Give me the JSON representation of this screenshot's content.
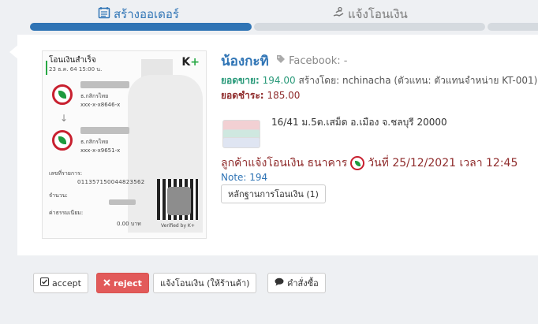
{
  "tabs": [
    {
      "label": "สร้างออเดอร์",
      "icon": "calendar-list-icon",
      "active": true
    },
    {
      "label": "แจ้งโอนเงิน",
      "icon": "hand-money-icon",
      "active": false
    }
  ],
  "order": {
    "customer_name": "น้องกะทิ",
    "facebook": "Facebook: -",
    "sales_label": "ยอดขาย:",
    "sales_value": "194.00",
    "created_by": "สร้างโดย: nchinacha (ตัวแทน: ตัวแทนจำหน่าย KT-001)",
    "paid_label": "ยอดชำระ:",
    "paid_value": "185.00",
    "address": "16/41 ม.5ต.เสม็ด อ.เมือง จ.ชลบุรี 20000",
    "transfer_text_prefix": "ลูกค้าแจ้งโอนเงิน ธนาคาร",
    "transfer_text_suffix": "วันที่ 25/12/2021 เวลา 12:45",
    "note": "Note: 194",
    "proof_button": "หลักฐานการโอนเงิน (1)"
  },
  "slip": {
    "title": "โอนเงินสำเร็จ",
    "date": "23 ธ.ค. 64  15:00 น.",
    "brand": "K",
    "brand_plus": "+",
    "from_bank": "ธ.กสิกรไทย",
    "from_account": "xxx-x-x8646-x",
    "to_bank": "ธ.กสิกรไทย",
    "to_account": "xxx-x-x9651-x",
    "arrow": "↓",
    "ref_label": "เลขที่รายการ:",
    "ref_value": "011357150044823562",
    "amount_label": "จำนวน:",
    "fee_label": "ค่าธรรมเนียม:",
    "fee_value": "0.00 บาท",
    "verified": "Verified by K+"
  },
  "actions": {
    "accept": "accept",
    "reject": "reject",
    "notify_shop": "แจ้งโอนเงิน (ให้ร้านค้า)",
    "order_cmd": "คำสั่งซื้อ"
  },
  "colors": {
    "primary": "#2f74b5",
    "danger": "#e25a5a",
    "green": "#2a9a7a",
    "dark_red": "#8f2b2b"
  }
}
